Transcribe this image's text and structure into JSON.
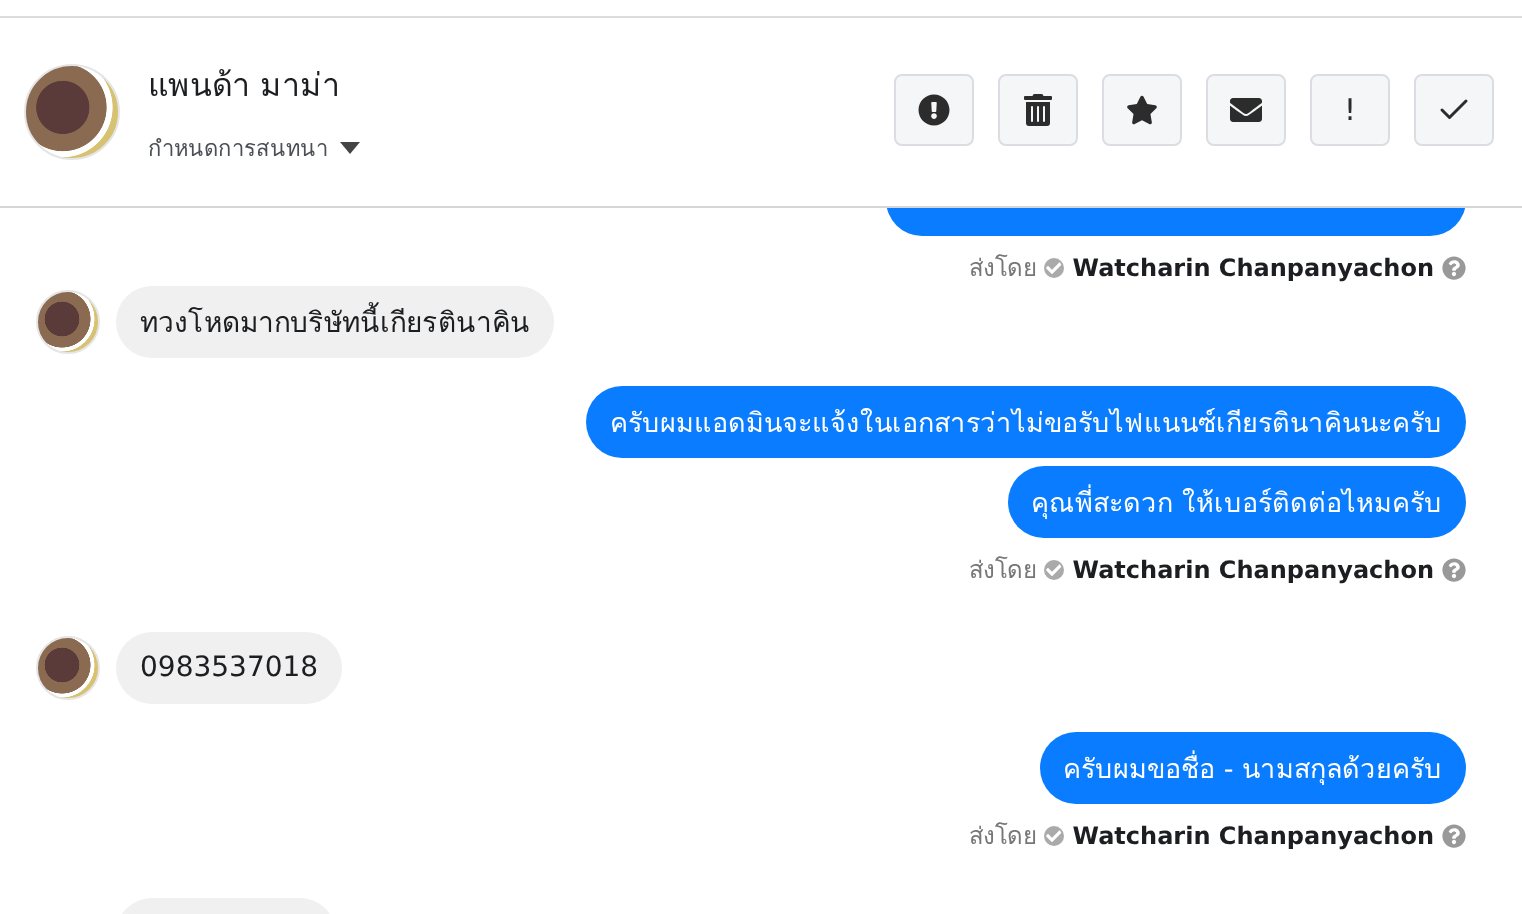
{
  "header": {
    "name": "แพนด้า มาม่า",
    "subtitle": "กำหนดการสนทนา",
    "actions": [
      {
        "kind": "alert"
      },
      {
        "kind": "trash"
      },
      {
        "kind": "star"
      },
      {
        "kind": "mail"
      },
      {
        "kind": "exclaim",
        "label": "!"
      },
      {
        "kind": "check"
      }
    ]
  },
  "messages": [
    {
      "kind": "outgoing",
      "clipped": true,
      "sent_by_label": "ส่งโดย",
      "sender": "Watcharin Chanpanyachon"
    },
    {
      "kind": "incoming",
      "bubbles": [
        "ทวงโหดมากบริษัทนี้เกียรตินาคิน"
      ]
    },
    {
      "kind": "outgoing",
      "clipped": false,
      "bubbles": [
        "ครับผมแอดมินจะแจ้งในเอกสารว่าไม่ขอรับไฟแนนซ์เกียรตินาคินนะครับ",
        "คุณพี่สะดวก ให้เบอร์ติดต่อไหมครับ"
      ],
      "sent_by_label": "ส่งโดย",
      "sender": "Watcharin Chanpanyachon"
    },
    {
      "kind": "incoming",
      "bubbles": [
        "0983537018"
      ]
    },
    {
      "kind": "outgoing",
      "clipped": false,
      "bubbles": [
        "ครับผมขอชื่อ - นามสกุลด้วยครับ"
      ],
      "sent_by_label": "ส่งโดย",
      "sender": "Watcharin Chanpanyachon"
    },
    {
      "kind": "incoming_clipped"
    }
  ]
}
